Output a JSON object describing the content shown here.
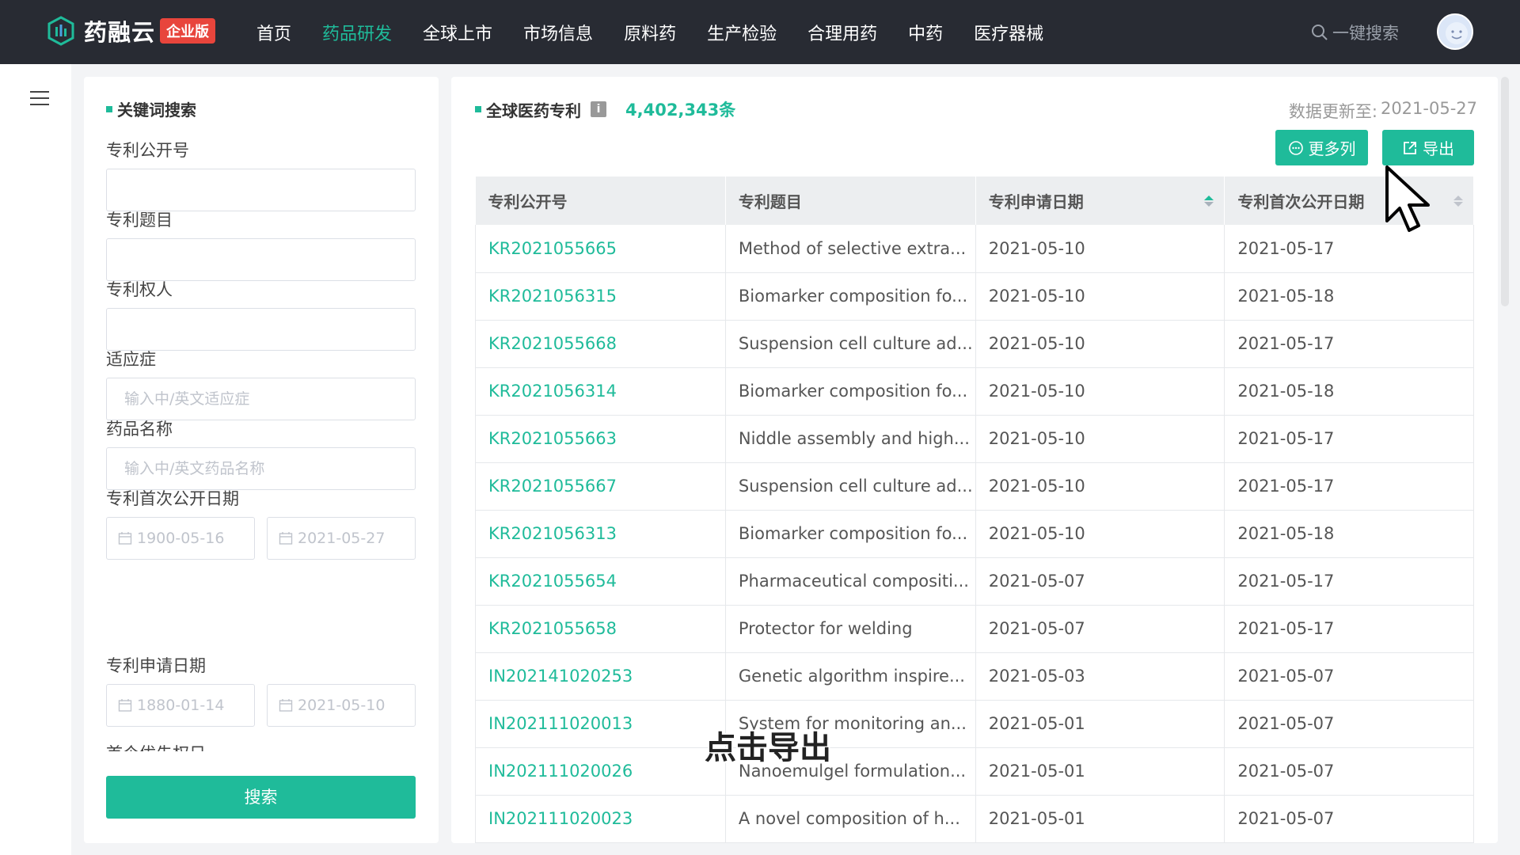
{
  "header": {
    "brand": "药融云",
    "edition_badge": "企业版",
    "nav": [
      "首页",
      "药品研发",
      "全球上市",
      "市场信息",
      "原料药",
      "生产检验",
      "合理用药",
      "中药",
      "医疗器械"
    ],
    "active_nav_index": 1,
    "search_label": "一键搜索",
    "icons": {
      "search": "search-icon",
      "avatar": "user-avatar"
    }
  },
  "filter": {
    "title": "关键词搜索",
    "fields": [
      {
        "label": "专利公开号",
        "value": "",
        "placeholder": ""
      },
      {
        "label": "专利题目",
        "value": "",
        "placeholder": ""
      },
      {
        "label": "专利权人",
        "value": "",
        "placeholder": ""
      },
      {
        "label": "适应症",
        "value": "",
        "placeholder": "输入中/英文适应症"
      },
      {
        "label": "药品名称",
        "value": "",
        "placeholder": "输入中/英文药品名称"
      }
    ],
    "pub_date": {
      "label": "专利首次公开日期",
      "from": "1900-05-16",
      "to": "2021-05-27"
    },
    "app_date": {
      "label": "专利申请日期",
      "from": "1880-01-14",
      "to": "2021-05-10"
    },
    "next_label_partial": "首个优先权日",
    "search_button": "搜索"
  },
  "main": {
    "title": "全球医药专利",
    "count": "4,402,343条",
    "update_label": "数据更新至:",
    "update_date": "2021-05-27",
    "more_columns_button": "更多列",
    "export_button": "导出",
    "columns": [
      "专利公开号",
      "专利题目",
      "专利申请日期",
      "专利首次公开日期"
    ],
    "rows": [
      [
        "KR2021055665",
        "Method of selective extra...",
        "2021-05-10",
        "2021-05-17"
      ],
      [
        "KR2021056315",
        "Biomarker composition fo...",
        "2021-05-10",
        "2021-05-18"
      ],
      [
        "KR2021055668",
        "Suspension cell culture ad...",
        "2021-05-10",
        "2021-05-17"
      ],
      [
        "KR2021056314",
        "Biomarker composition fo...",
        "2021-05-10",
        "2021-05-18"
      ],
      [
        "KR2021055663",
        "Niddle assembly and high...",
        "2021-05-10",
        "2021-05-17"
      ],
      [
        "KR2021055667",
        "Suspension cell culture ad...",
        "2021-05-10",
        "2021-05-17"
      ],
      [
        "KR2021056313",
        "Biomarker composition fo...",
        "2021-05-10",
        "2021-05-18"
      ],
      [
        "KR2021055654",
        "Pharmaceutical compositi...",
        "2021-05-07",
        "2021-05-17"
      ],
      [
        "KR2021055658",
        "Protector for welding",
        "2021-05-07",
        "2021-05-17"
      ],
      [
        "IN202141020253",
        "Genetic algorithm inspire...",
        "2021-05-03",
        "2021-05-07"
      ],
      [
        "IN202111020013",
        "System for monitoring an...",
        "2021-05-01",
        "2021-05-07"
      ],
      [
        "IN202111020026",
        "Nanoemulgel formulation...",
        "2021-05-01",
        "2021-05-07"
      ],
      [
        "IN202111020023",
        "A novel composition of h...",
        "2021-05-01",
        "2021-05-07"
      ]
    ]
  },
  "overlay_caption": "点击导出",
  "colors": {
    "accent": "#1fbb9a",
    "topbar": "#282b33",
    "badge": "#e8453c"
  }
}
